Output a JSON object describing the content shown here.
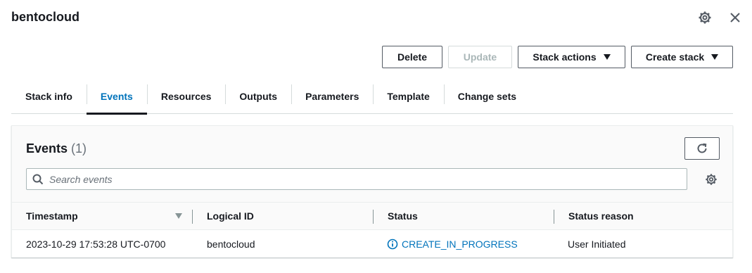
{
  "header": {
    "title": "bentocloud",
    "settings_icon": "gear-icon",
    "close_icon": "close-icon"
  },
  "actions": {
    "delete_label": "Delete",
    "update_label": "Update",
    "stack_actions_label": "Stack actions",
    "create_stack_label": "Create stack"
  },
  "tabs": [
    {
      "label": "Stack info"
    },
    {
      "label": "Events",
      "active": true
    },
    {
      "label": "Resources"
    },
    {
      "label": "Outputs"
    },
    {
      "label": "Parameters"
    },
    {
      "label": "Template"
    },
    {
      "label": "Change sets"
    }
  ],
  "events": {
    "title": "Events",
    "count": "(1)",
    "search_placeholder": "Search events",
    "search_value": "",
    "columns": [
      "Timestamp",
      "Logical ID",
      "Status",
      "Status reason"
    ],
    "rows": [
      {
        "timestamp": "2023-10-29 17:53:28 UTC-0700",
        "logical_id": "bentocloud",
        "status": "CREATE_IN_PROGRESS",
        "status_reason": "User Initiated"
      }
    ]
  },
  "colors": {
    "accent": "#0073bb",
    "text": "#16191f",
    "border": "#545b64",
    "disabled": "#aab7b8"
  }
}
